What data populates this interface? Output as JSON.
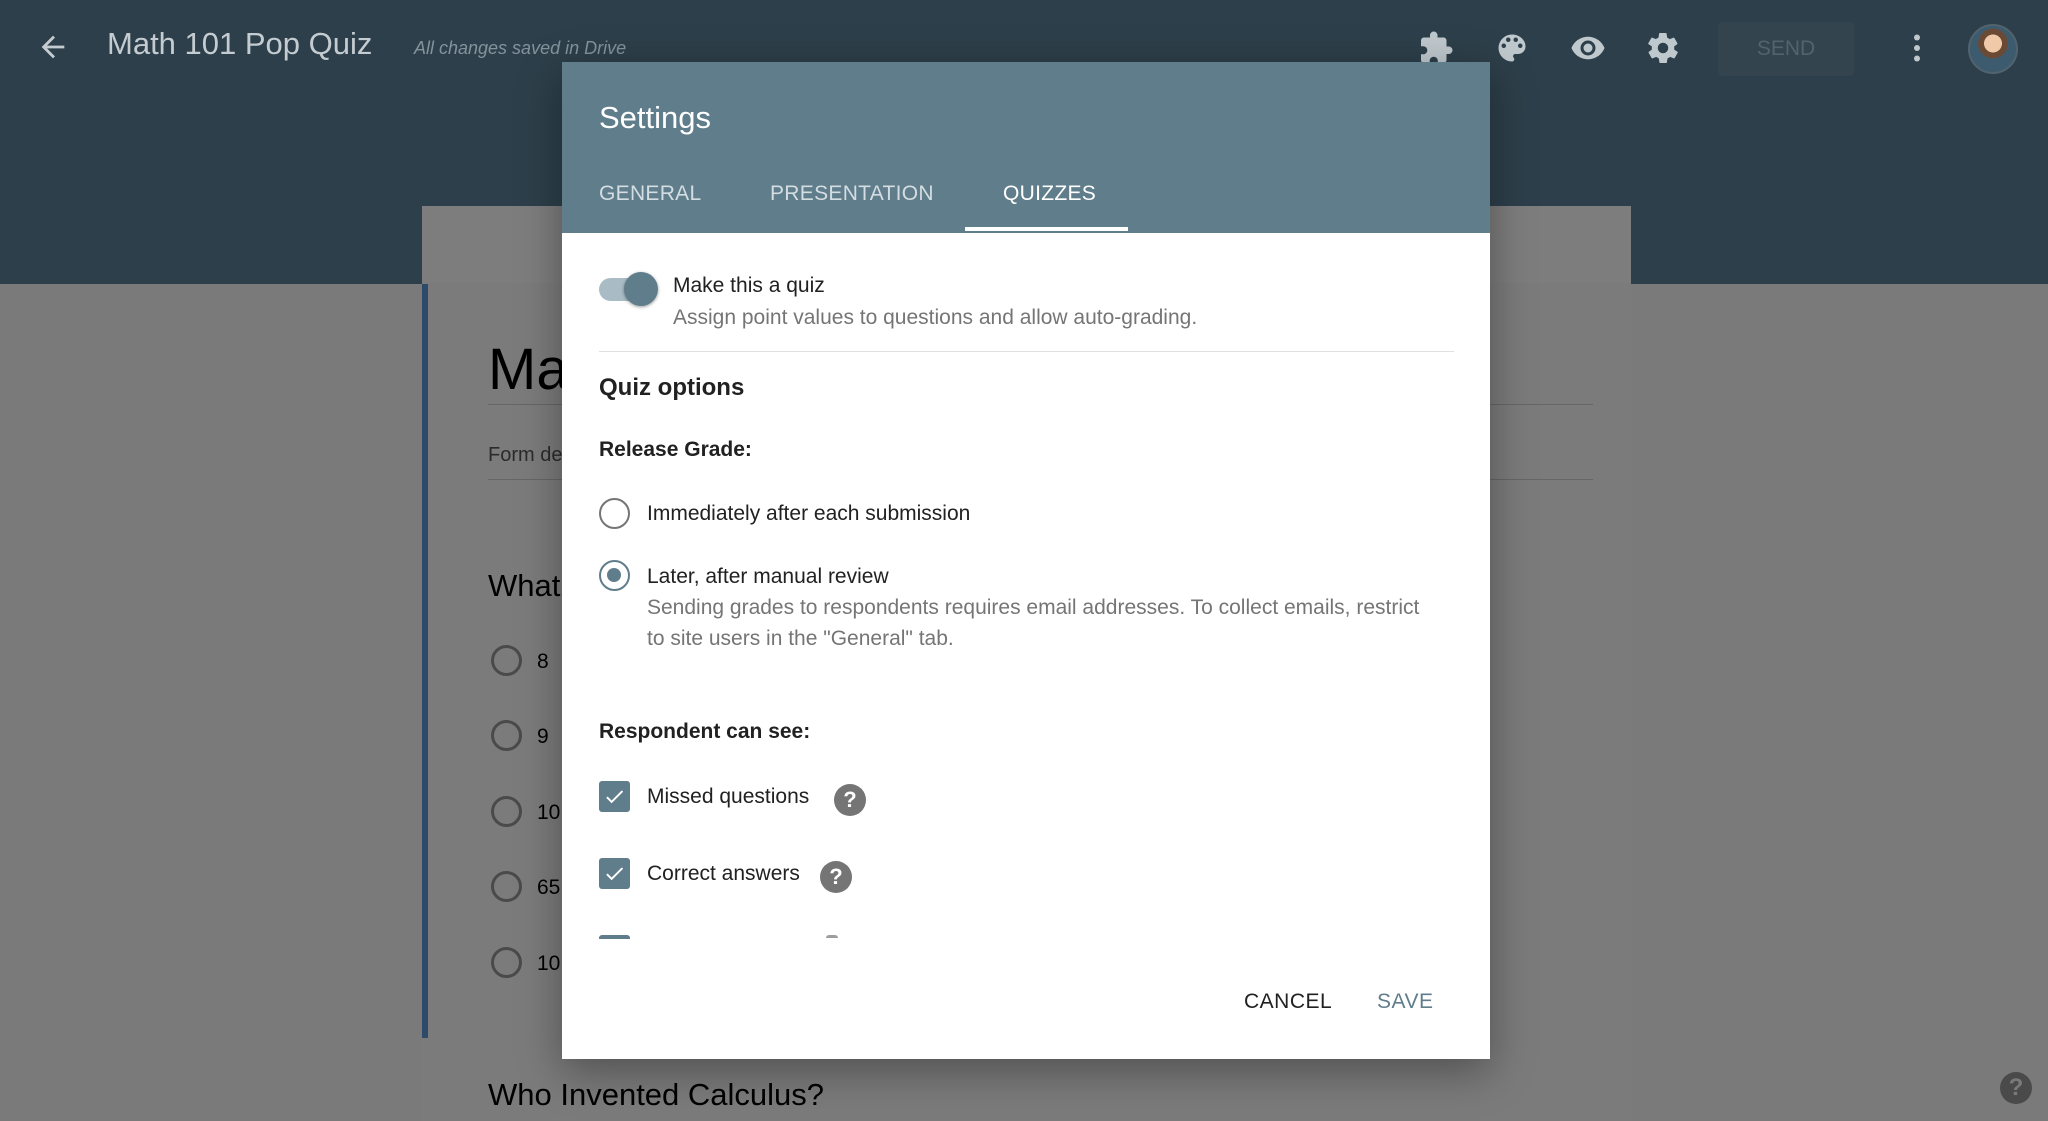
{
  "appbar": {
    "title": "Math 101 Pop Quiz",
    "save_status": "All changes saved in Drive",
    "send_label": "SEND",
    "icons": [
      "back-arrow-icon",
      "puzzle-icon",
      "palette-icon",
      "eye-icon",
      "gear-icon",
      "more-vert-icon"
    ]
  },
  "form": {
    "title": "Ma",
    "description": "Form de",
    "q1_title": "What",
    "q1_options": [
      "8",
      "9",
      "10",
      "65",
      "10"
    ],
    "q2_title": "Who Invented Calculus?",
    "help_label": "?"
  },
  "dialog": {
    "title": "Settings",
    "tabs": [
      {
        "label": "GENERAL",
        "active": false
      },
      {
        "label": "PRESENTATION",
        "active": false
      },
      {
        "label": "QUIZZES",
        "active": true
      }
    ],
    "quiz_toggle": {
      "label": "Make this a quiz",
      "description": "Assign point values to questions and allow auto-grading.",
      "on": true
    },
    "quiz_options_title": "Quiz options",
    "release_grade": {
      "title": "Release Grade:",
      "options": [
        {
          "label": "Immediately after each submission",
          "checked": false
        },
        {
          "label": "Later, after manual review",
          "checked": true
        }
      ],
      "later_description": "Sending grades to respondents requires email addresses. To collect emails, restrict to site users in the \"General\" tab."
    },
    "respondent": {
      "title": "Respondent can see:",
      "items": [
        {
          "label": "Missed questions",
          "checked": true,
          "help": "?"
        },
        {
          "label": "Correct answers",
          "checked": true,
          "help": "?"
        }
      ]
    },
    "cancel_label": "CANCEL",
    "save_label": "SAVE"
  },
  "colors": {
    "appbar": "#2d3f4a",
    "dialog_header": "#607d8b",
    "accent": "#607d8b",
    "overlay_gray": "#7a7a7a"
  }
}
